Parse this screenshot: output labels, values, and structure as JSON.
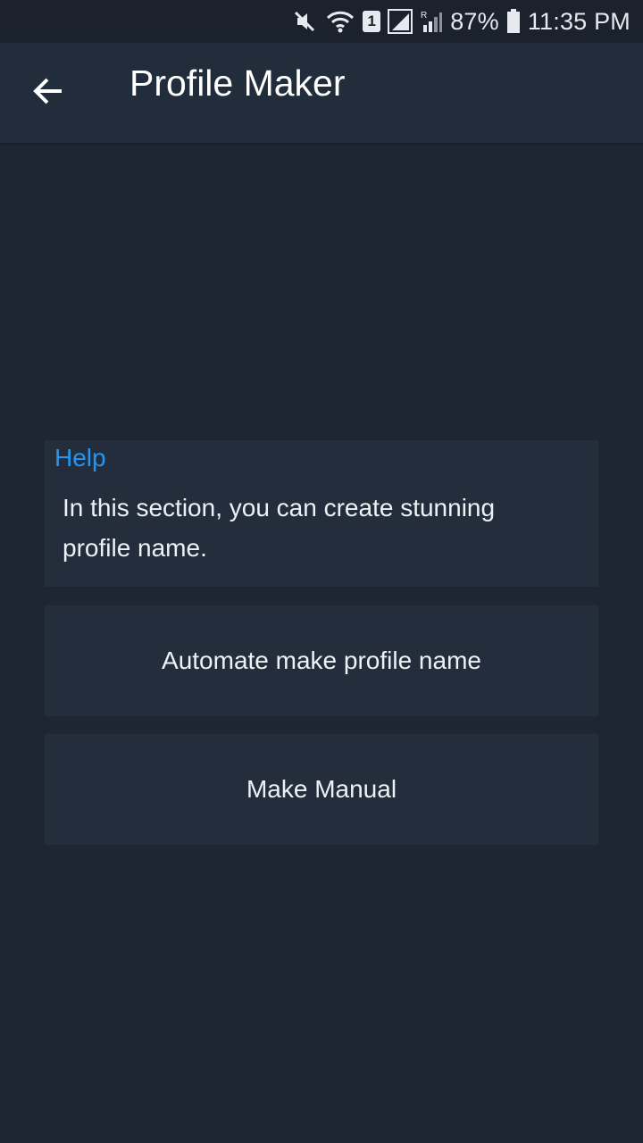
{
  "status_bar": {
    "icons": [
      "mute-icon",
      "wifi-icon",
      "sim-icon",
      "signal-icon",
      "signal-roaming-icon",
      "battery-icon"
    ],
    "sim_label": "1",
    "battery_percent": "87%",
    "time": "11:35 PM"
  },
  "app_bar": {
    "back_icon": "arrow-back-icon",
    "title": "Profile Maker"
  },
  "help": {
    "title": "Help",
    "body": "In this section, you can create stunning profile name."
  },
  "actions": {
    "automate_label": "Automate make profile name",
    "manual_label": "Make Manual"
  },
  "colors": {
    "background": "#1e2633",
    "app_bar": "#222d3b",
    "card": "#232d3c",
    "accent": "#2196f3"
  }
}
